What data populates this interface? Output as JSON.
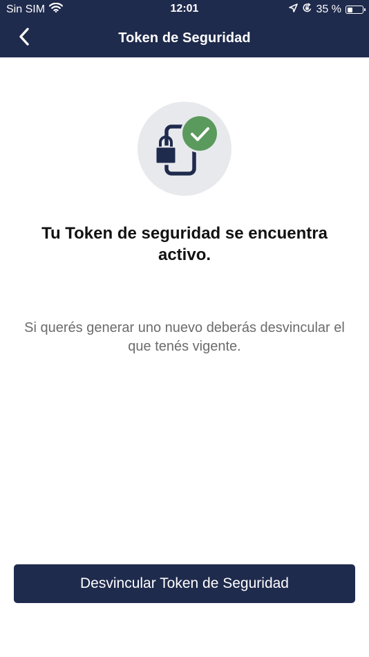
{
  "status_bar": {
    "carrier": "Sin SIM",
    "time": "12:01",
    "battery_text": "35 %",
    "battery_level": 0.35
  },
  "navbar": {
    "title": "Token de Seguridad",
    "back_icon": "chevron-left-icon"
  },
  "illustration": {
    "icons": [
      "phone-icon",
      "lock-icon",
      "check-icon"
    ],
    "colors": {
      "circle_bg": "#e8e9ed",
      "phone": "#1f2b4d",
      "check_badge": "#5b9a5d"
    }
  },
  "content": {
    "heading": "Tu Token de seguridad se encuentra activo.",
    "description": "Si querés generar uno nuevo deberás desvincular el que tenés vigente."
  },
  "actions": {
    "unlink_label": "Desvincular Token de Seguridad"
  },
  "theme": {
    "primary": "#1f2b4d",
    "text": "#111111",
    "muted_text": "#6b6b6b",
    "background": "#ffffff"
  }
}
